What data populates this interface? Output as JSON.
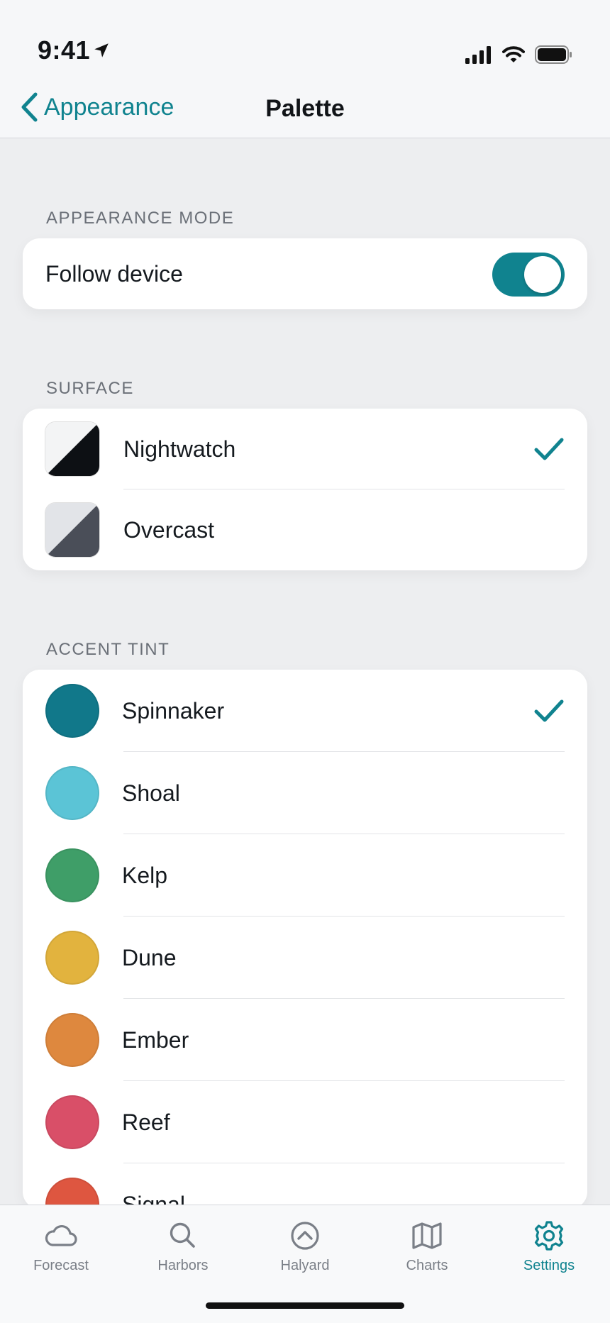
{
  "status": {
    "time": "9:41"
  },
  "nav": {
    "back_label": "Appearance",
    "title": "Palette"
  },
  "mode": {
    "header": "APPEARANCE MODE",
    "follow_label": "Follow device",
    "follow_on": true
  },
  "surface": {
    "header": "SURFACE",
    "items": [
      {
        "label": "Nightwatch",
        "selected": true,
        "light": "#F3F4F5",
        "dark": "#0D1014"
      },
      {
        "label": "Overcast",
        "selected": false,
        "light": "#E2E4E8",
        "dark": "#4A4E58"
      }
    ]
  },
  "accent": {
    "header": "ACCENT TINT",
    "items": [
      {
        "label": "Spinnaker",
        "color": "#11788A",
        "selected": true
      },
      {
        "label": "Shoal",
        "color": "#5BC4D6",
        "selected": false
      },
      {
        "label": "Kelp",
        "color": "#3F9E68",
        "selected": false
      },
      {
        "label": "Dune",
        "color": "#E2B33E",
        "selected": false
      },
      {
        "label": "Ember",
        "color": "#DE883E",
        "selected": false
      },
      {
        "label": "Reef",
        "color": "#D94F68",
        "selected": false
      },
      {
        "label": "Signal",
        "color": "#DE5640",
        "selected": false
      }
    ]
  },
  "tabs": [
    {
      "label": "Forecast",
      "icon": "cloud-icon",
      "active": false
    },
    {
      "label": "Harbors",
      "icon": "search-icon",
      "active": false
    },
    {
      "label": "Halyard",
      "icon": "arrow-up-circle-icon",
      "active": false
    },
    {
      "label": "Charts",
      "icon": "map-icon",
      "active": false
    },
    {
      "label": "Settings",
      "icon": "gear-icon",
      "active": true
    }
  ],
  "colors": {
    "accent": "#10838F",
    "background": "#EDEEF0"
  }
}
